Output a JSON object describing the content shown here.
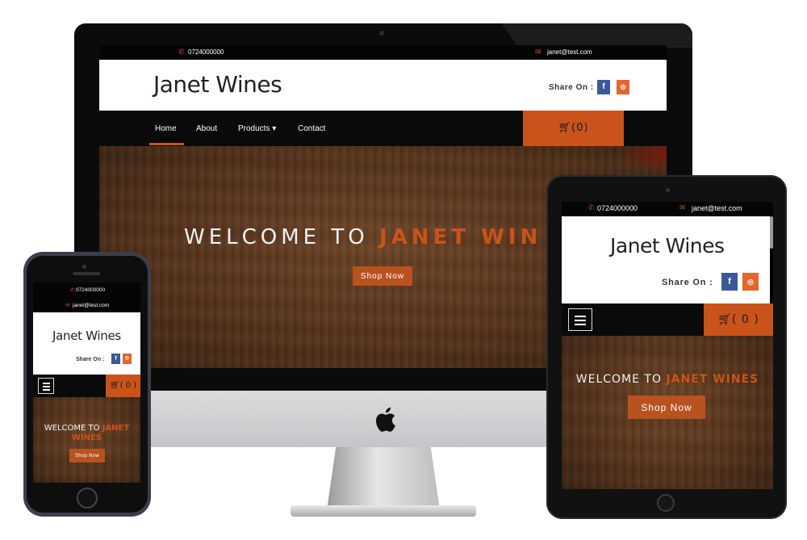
{
  "site": {
    "phone": "0724000000",
    "email": "janet@test.com",
    "brand": "Janet Wines",
    "share_label": "Share On :",
    "facebook_glyph": "f",
    "instagram_glyph": "◎",
    "cart_label": "(0)",
    "cart_label_spaced": "( 0 )",
    "nav": {
      "home": "Home",
      "about": "About",
      "products": "Products ▾",
      "contact": "Contact"
    },
    "hero": {
      "welcome_part": "WELCOME TO",
      "brand_part": "JANET WINES",
      "brand_part_cut": "JANET WIN",
      "brand_part_phone": "JANET",
      "brand_part_phone_line2": "WINES",
      "shop_button": "Shop Now"
    }
  },
  "icons": {
    "phone": "phone-icon",
    "mail": "envelope-icon",
    "cart": "cart-icon",
    "menu": "hamburger-menu-icon",
    "apple": "apple-logo-icon"
  },
  "colors": {
    "accent": "#c9531b",
    "facebook": "#3b5998",
    "instagram": "#e4652d",
    "nav_bg": "#0a0a0a"
  }
}
